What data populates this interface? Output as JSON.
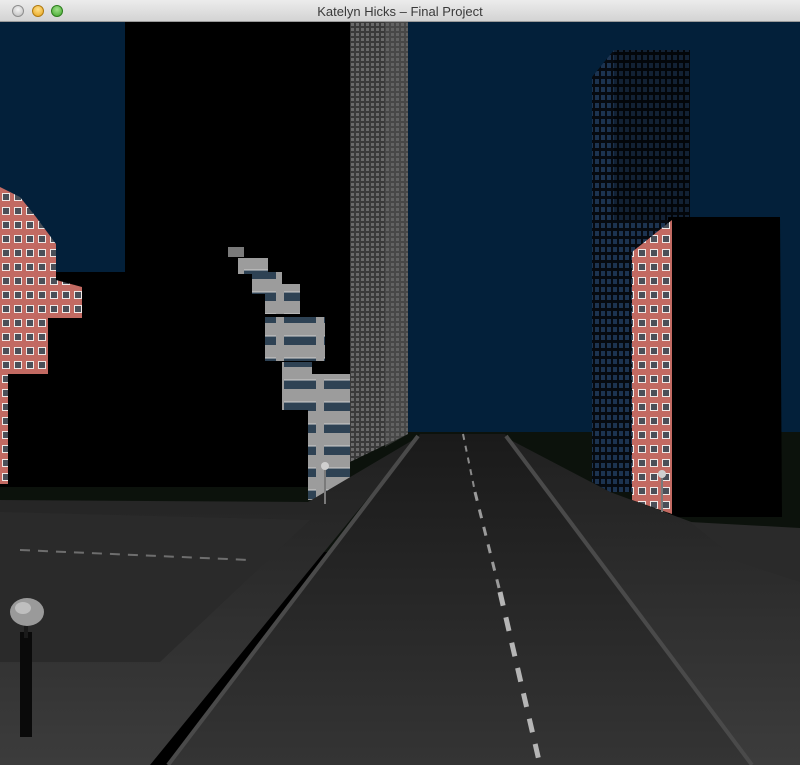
{
  "window": {
    "title": "Katelyn Hicks – Final Project",
    "controls": [
      "close-button",
      "minimize-button",
      "maximize-button"
    ]
  },
  "scene": {
    "sky_color": "#03203a",
    "ground_color": "#0c120c",
    "road_color": "#2c2c2c",
    "building_brick_color": "#c26a62",
    "building_concrete_color": "#9a9a9a",
    "window_glass_color": "#2b4a6a"
  }
}
